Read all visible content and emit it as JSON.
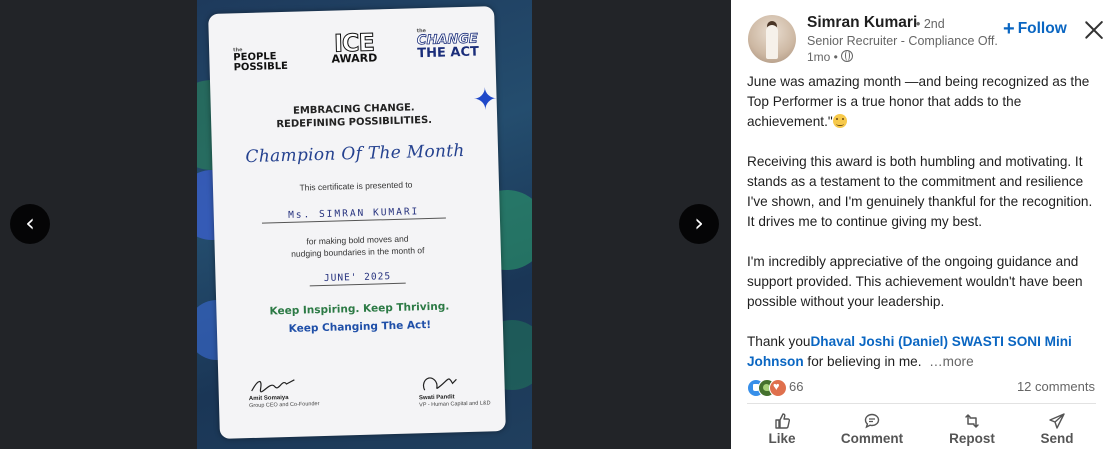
{
  "viewer": {
    "prev_label": "‹",
    "next_label": "›",
    "certificate": {
      "logo_left_small": "the",
      "logo_left": "PEOPLE POSSIBLE",
      "logo_mid_big": "ICE",
      "logo_mid_small": "AWARD",
      "logo_right_small": "the",
      "logo_right_1": "CHANGE",
      "logo_right_2": "THE ACT",
      "heading_1": "EMBRACING CHANGE.",
      "heading_2": "REDEFINING POSSIBILITIES.",
      "title": "Champion Of The Month",
      "presented": "This certificate is presented to",
      "recipient": "Ms. SIMRAN KUMARI",
      "reason_1": "for making bold moves and",
      "reason_2": "nudging boundaries in the month of",
      "month": "JUNE' 2025",
      "motto_1": "Keep Inspiring. Keep Thriving.",
      "motto_2": "Keep Changing The Act!",
      "signer_1_name": "Amit Somaiya",
      "signer_1_role": "Group CEO and Co-Founder",
      "signer_2_name": "Swati Pandit",
      "signer_2_role": "VP - Human Capital and L&D"
    }
  },
  "post": {
    "author": {
      "name": "Simran Kumari",
      "degree": "• 2nd",
      "headline": "Senior Recruiter - Compliance Off...",
      "time": "1mo •"
    },
    "follow_label": "Follow",
    "follow_plus": "+",
    "paragraph_1": "June was amazing month —and being recognized as the Top Performer is a true honor that adds to the achievement.\"",
    "paragraph_2": "Receiving this award is both humbling and motivating. It stands as a testament to the commitment and resilience I've shown, and I'm genuinely thankful for the recognition. It drives me to continue giving my best.",
    "paragraph_3": "I'm incredibly appreciative of the ongoing guidance and support provided. This achievement wouldn't have been possible without your leadership.",
    "thanks_prefix": "Thank you",
    "mentions": [
      "Dhaval Joshi (Daniel)",
      "SWASTI SONI",
      "Mini Johnson"
    ],
    "thanks_suffix": " for believing in me.",
    "more_label": "…more",
    "reaction_count": "66",
    "comments_label": "12 comments",
    "actions": {
      "like": "Like",
      "comment": "Comment",
      "repost": "Repost",
      "send": "Send"
    }
  },
  "colors": {
    "link": "#0a66c2",
    "cert_green": "#2c7a45",
    "cert_blue": "#1f4fa8"
  }
}
